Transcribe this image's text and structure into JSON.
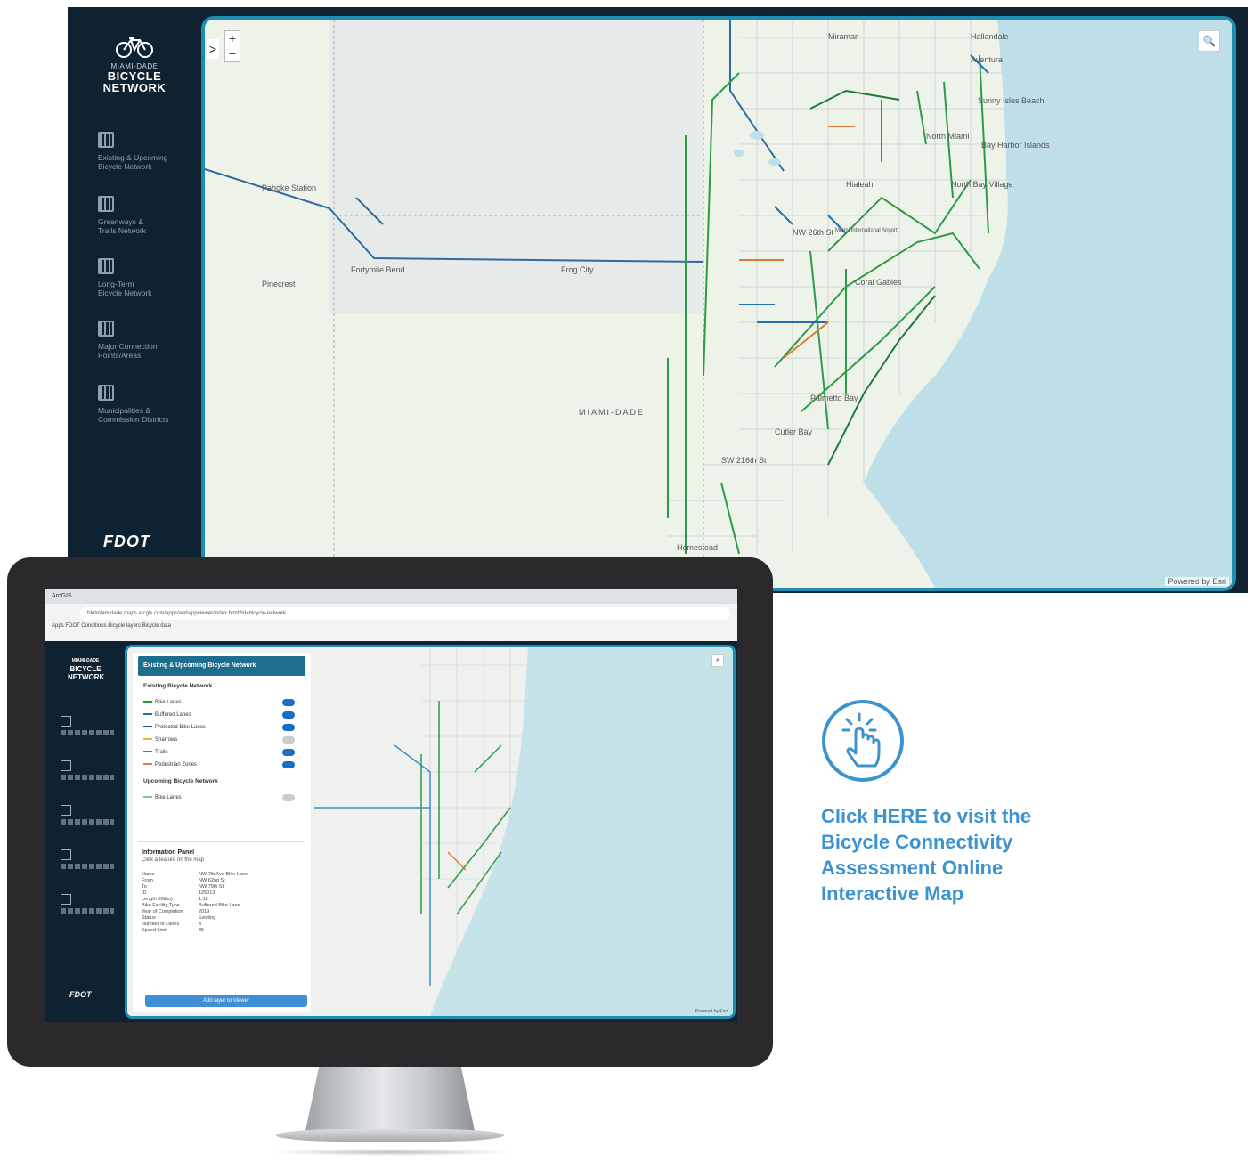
{
  "app": {
    "logo": {
      "line1": "MIAMI-DADE",
      "line2": "BICYCLE",
      "line3": "NETWORK"
    },
    "nav": [
      {
        "label": "Existing & Upcoming\nBicycle Network",
        "icon": "grid-map-icon"
      },
      {
        "label": "Greenways &\nTrails Network",
        "icon": "leaf-icon"
      },
      {
        "label": "Long-Term\nBicycle Network",
        "icon": "grid-map-icon"
      },
      {
        "label": "Major Connection\nPoints/Areas",
        "icon": "route-icon"
      },
      {
        "label": "Municipalities &\nCommission Districts",
        "icon": "boundary-icon"
      }
    ],
    "footer_logo": "FDOT",
    "map": {
      "zoom_in": "+",
      "zoom_out": "−",
      "expand": ">",
      "search": "🔍",
      "attribution": "Powered by Esri",
      "labels": [
        "Miramar",
        "Hallandale",
        "North Miami",
        "Hialeah",
        "Coral Gables",
        "Pinecrest",
        "Palmetto Bay",
        "Cutler Bay",
        "Homestead",
        "MIAMI-DADE",
        "Pahoke Station",
        "Fortymile Bend",
        "Frog City",
        "NW 26th St",
        "SW 216th St",
        "Miami International Airport",
        "North Bay Village",
        "Bay Harbor Islands",
        "Aventura",
        "Sunny Isles Beach"
      ]
    }
  },
  "monitor": {
    "browser": {
      "tab": "ArcGIS",
      "url": "fdotmiamidade.maps.arcgis.com/apps/webappviewer/index.html?id=bicycle-network",
      "bookmarks": "Apps   FDOT   Conditions   Bicycle layers   Bicycle data"
    },
    "panel": {
      "title": "Existing & Upcoming Bicycle Network",
      "subtitle": "Existing Bicycle Network",
      "layers": [
        {
          "label": "Bike Lanes",
          "color": "#2d9b46",
          "on": true
        },
        {
          "label": "Buffered Lanes",
          "color": "#1f6fb2",
          "on": true
        },
        {
          "label": "Protected Bike Lanes",
          "color": "#1f4fa0",
          "on": true
        },
        {
          "label": "Sharrows",
          "color": "#f2b23a",
          "on": false
        },
        {
          "label": "Trails",
          "color": "#2d9b46",
          "on": true
        },
        {
          "label": "Pedestrian Zones",
          "color": "#e07a3a",
          "on": true
        }
      ],
      "upcoming_label": "Upcoming Bicycle Network",
      "upcoming_layer": "Bike Lanes",
      "info_title": "Information Panel",
      "info_sub": "Click a feature on the map",
      "info_rows": [
        [
          "Name",
          "NW 7th Ave Bike Lane"
        ],
        [
          "From",
          "NW 62nd St"
        ],
        [
          "To",
          "NW 79th St"
        ],
        [
          "ID",
          "125013"
        ],
        [
          "Length (Miles)",
          "1.12"
        ],
        [
          "Bike Facility Type",
          "Buffered Bike Lane"
        ],
        [
          "Year of Completion",
          "2019"
        ],
        [
          "Status",
          "Existing"
        ],
        [
          "Number of Lanes",
          "4"
        ],
        [
          "Speed Limit",
          "35"
        ]
      ],
      "button": "Add layer to Viewer"
    },
    "footer_logo": "FDOT",
    "attribution": "Powered by Esri"
  },
  "cta": {
    "text": "Click HERE to visit the Bicycle Connectivity Assessment Online Interactive Map",
    "icon": "tap-hand-icon",
    "color": "#3c93d0"
  },
  "colors": {
    "sidebar": "#0e2232",
    "frame": "#1e8db0",
    "water": "#bfdfe8",
    "land": "#eef3ea",
    "bike_green": "#2d9b46",
    "bike_blue": "#1f6fb2",
    "bike_orange": "#e07a3a"
  }
}
